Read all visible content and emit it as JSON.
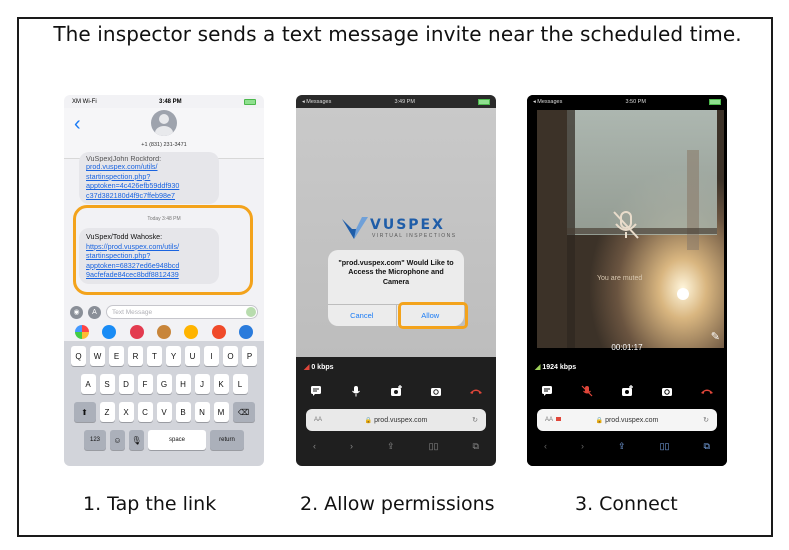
{
  "headline": "The inspector sends a text message invite near the scheduled time.",
  "captions": [
    "1. Tap the link",
    "2. Allow permissions",
    "3. Connect"
  ],
  "phone1": {
    "carrier": "XM Wi-Fi",
    "time": "3:48 PM",
    "contact_number": "+1 (831) 231-3471",
    "first_message_partial": "VuSpex|John Rockford:",
    "first_link_lines": [
      "prod.vuspex.com/utils/",
      "startinspection.php?",
      "apptoken=4c426efb59ddf930",
      "c37d382180d4f9c7ffeb98e7"
    ],
    "today_label": "Today 3:48 PM",
    "second_message_sender": "VuSpex/Todd Wahoske:",
    "second_link_lines": [
      "https://prod.vuspex.com/utils/",
      "startinspection.php?",
      "apptoken=68327ed6e948bcd",
      "9acfefade84cec8bdf8812439"
    ],
    "composer_placeholder": "Text Message",
    "keyboard_row1": [
      "Q",
      "W",
      "E",
      "R",
      "T",
      "Y",
      "U",
      "I",
      "O",
      "P"
    ],
    "keyboard_row2": [
      "A",
      "S",
      "D",
      "F",
      "G",
      "H",
      "J",
      "K",
      "L"
    ],
    "keyboard_row3": [
      "Z",
      "X",
      "C",
      "V",
      "B",
      "N",
      "M"
    ],
    "key_numbers": "123",
    "key_space": "space",
    "key_return": "return"
  },
  "phone2": {
    "back_label": "◂ Messages",
    "time": "3:49 PM",
    "logo_brand": "VUSPEX",
    "logo_sub": "VIRTUAL INSPECTIONS",
    "dialog_message": "\"prod.vuspex.com\" Would Like to Access the Microphone and Camera",
    "cancel_label": "Cancel",
    "allow_label": "Allow",
    "bitrate": "0 kbps",
    "aa_label": "AA",
    "url": "prod.vuspex.com"
  },
  "phone3": {
    "back_label": "◂ Messages",
    "time": "3:50 PM",
    "muted_text": "You are muted",
    "timer": "00:01:17",
    "bitrate": "1924 kbps",
    "aa_label": "AA",
    "url": "prod.vuspex.com"
  },
  "colors": {
    "highlight": "#f3a31c",
    "ios_blue": "#1a7bf5",
    "end_call_red": "#e0463a"
  }
}
